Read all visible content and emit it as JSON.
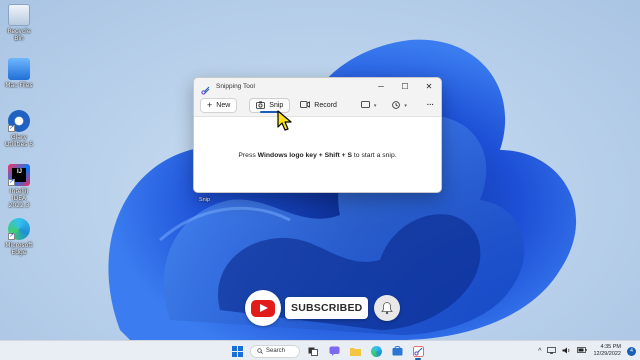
{
  "desktop": {
    "icons": [
      {
        "label": "Recycle Bin",
        "icon": "recycle-bin-icon"
      },
      {
        "label": "Mac Files",
        "icon": "folder-icon"
      },
      {
        "label": "Glary Utilities 5",
        "icon": "glary-utilities-icon"
      },
      {
        "label": "IntelliJ IDEA 2022.3",
        "icon": "intellij-idea-icon"
      },
      {
        "label": "Microsoft Edge",
        "icon": "edge-icon"
      }
    ],
    "hidden_label": "Snip"
  },
  "window": {
    "title": "Snipping Tool",
    "controls": {
      "minimize": "─",
      "maximize": "☐",
      "close": "✕"
    },
    "toolbar": {
      "new_label": "New",
      "snip_label": "Snip",
      "record_label": "Record",
      "more_label": "···"
    },
    "message": {
      "prefix": "Press ",
      "key1": "Windows logo key",
      "plus1": " + ",
      "key2": "Shift",
      "plus2": " + ",
      "key3": "S",
      "suffix": " to start a snip."
    }
  },
  "overlay": {
    "subscribed_label": "SUBSCRIBED"
  },
  "taskbar": {
    "search_label": "Search",
    "time": "4:35 PM",
    "date": "12/29/2022",
    "notification_count": "4",
    "tray_chevron": "^"
  },
  "colors": {
    "accent": "#1a5fb4",
    "youtube_red": "#e21b1b",
    "wallpaper_blue": "#1d4fd6"
  }
}
